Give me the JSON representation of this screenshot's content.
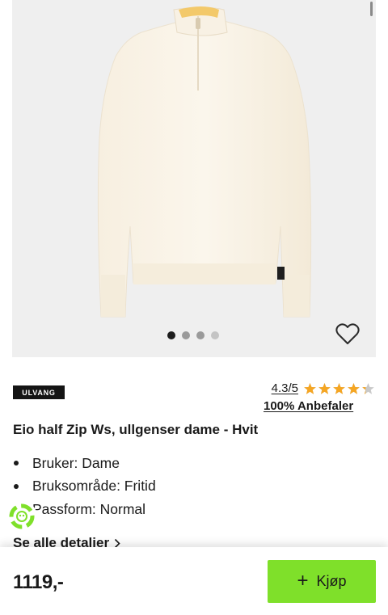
{
  "product": {
    "brand": "ULVANG",
    "title": "Eio half Zip Ws, ullgenser dame - Hvit",
    "rating": "4.3/5",
    "rating_score": 4.3,
    "rating_max": 5,
    "recommend": "100% Anbefaler",
    "specs": [
      "Bruker: Dame",
      "Bruksområde: Fritid",
      "Passform: Normal"
    ],
    "details_link": "Se alle detaljer",
    "price": "1119,-"
  },
  "gallery": {
    "image_count": 4,
    "active_index": 0
  },
  "actions": {
    "buy_label": "Kjøp"
  },
  "colors": {
    "buy_button": "#7fe02a",
    "star": "#f5a623",
    "brand_badge": "#141414",
    "gallery_bg": "#efefef"
  },
  "icons": [
    "heart-icon",
    "star-icon",
    "chevron-right-icon",
    "plus-icon",
    "chat-icon"
  ]
}
